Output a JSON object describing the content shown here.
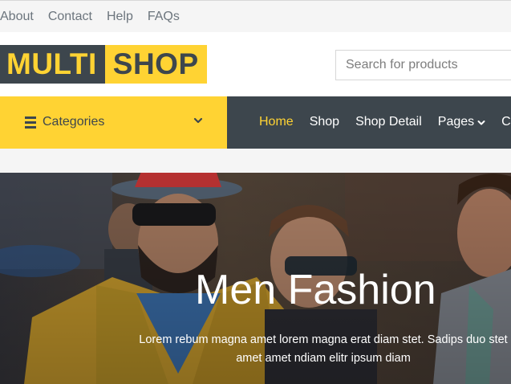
{
  "topbar": {
    "links": [
      "About",
      "Contact",
      "Help",
      "FAQs"
    ]
  },
  "logo": {
    "part1": "MULTI",
    "part2": "SHOP"
  },
  "search": {
    "placeholder": "Search for products"
  },
  "nav": {
    "categories_label": "Categories",
    "links": [
      "Home",
      "Shop",
      "Shop Detail",
      "Pages",
      "Co"
    ],
    "active": "Home"
  },
  "hero": {
    "title": "Men Fashion",
    "description": "Lorem rebum magna amet lorem magna erat diam stet. Sadips duo stet amet amet ndiam elitr ipsum diam"
  },
  "colors": {
    "accent": "#ffd333",
    "dark": "#3d464d"
  },
  "icons": {
    "categories": "menu-bars-icon",
    "categories_toggle": "chevron-down-icon",
    "pages_dropdown": "chevron-down-icon"
  }
}
